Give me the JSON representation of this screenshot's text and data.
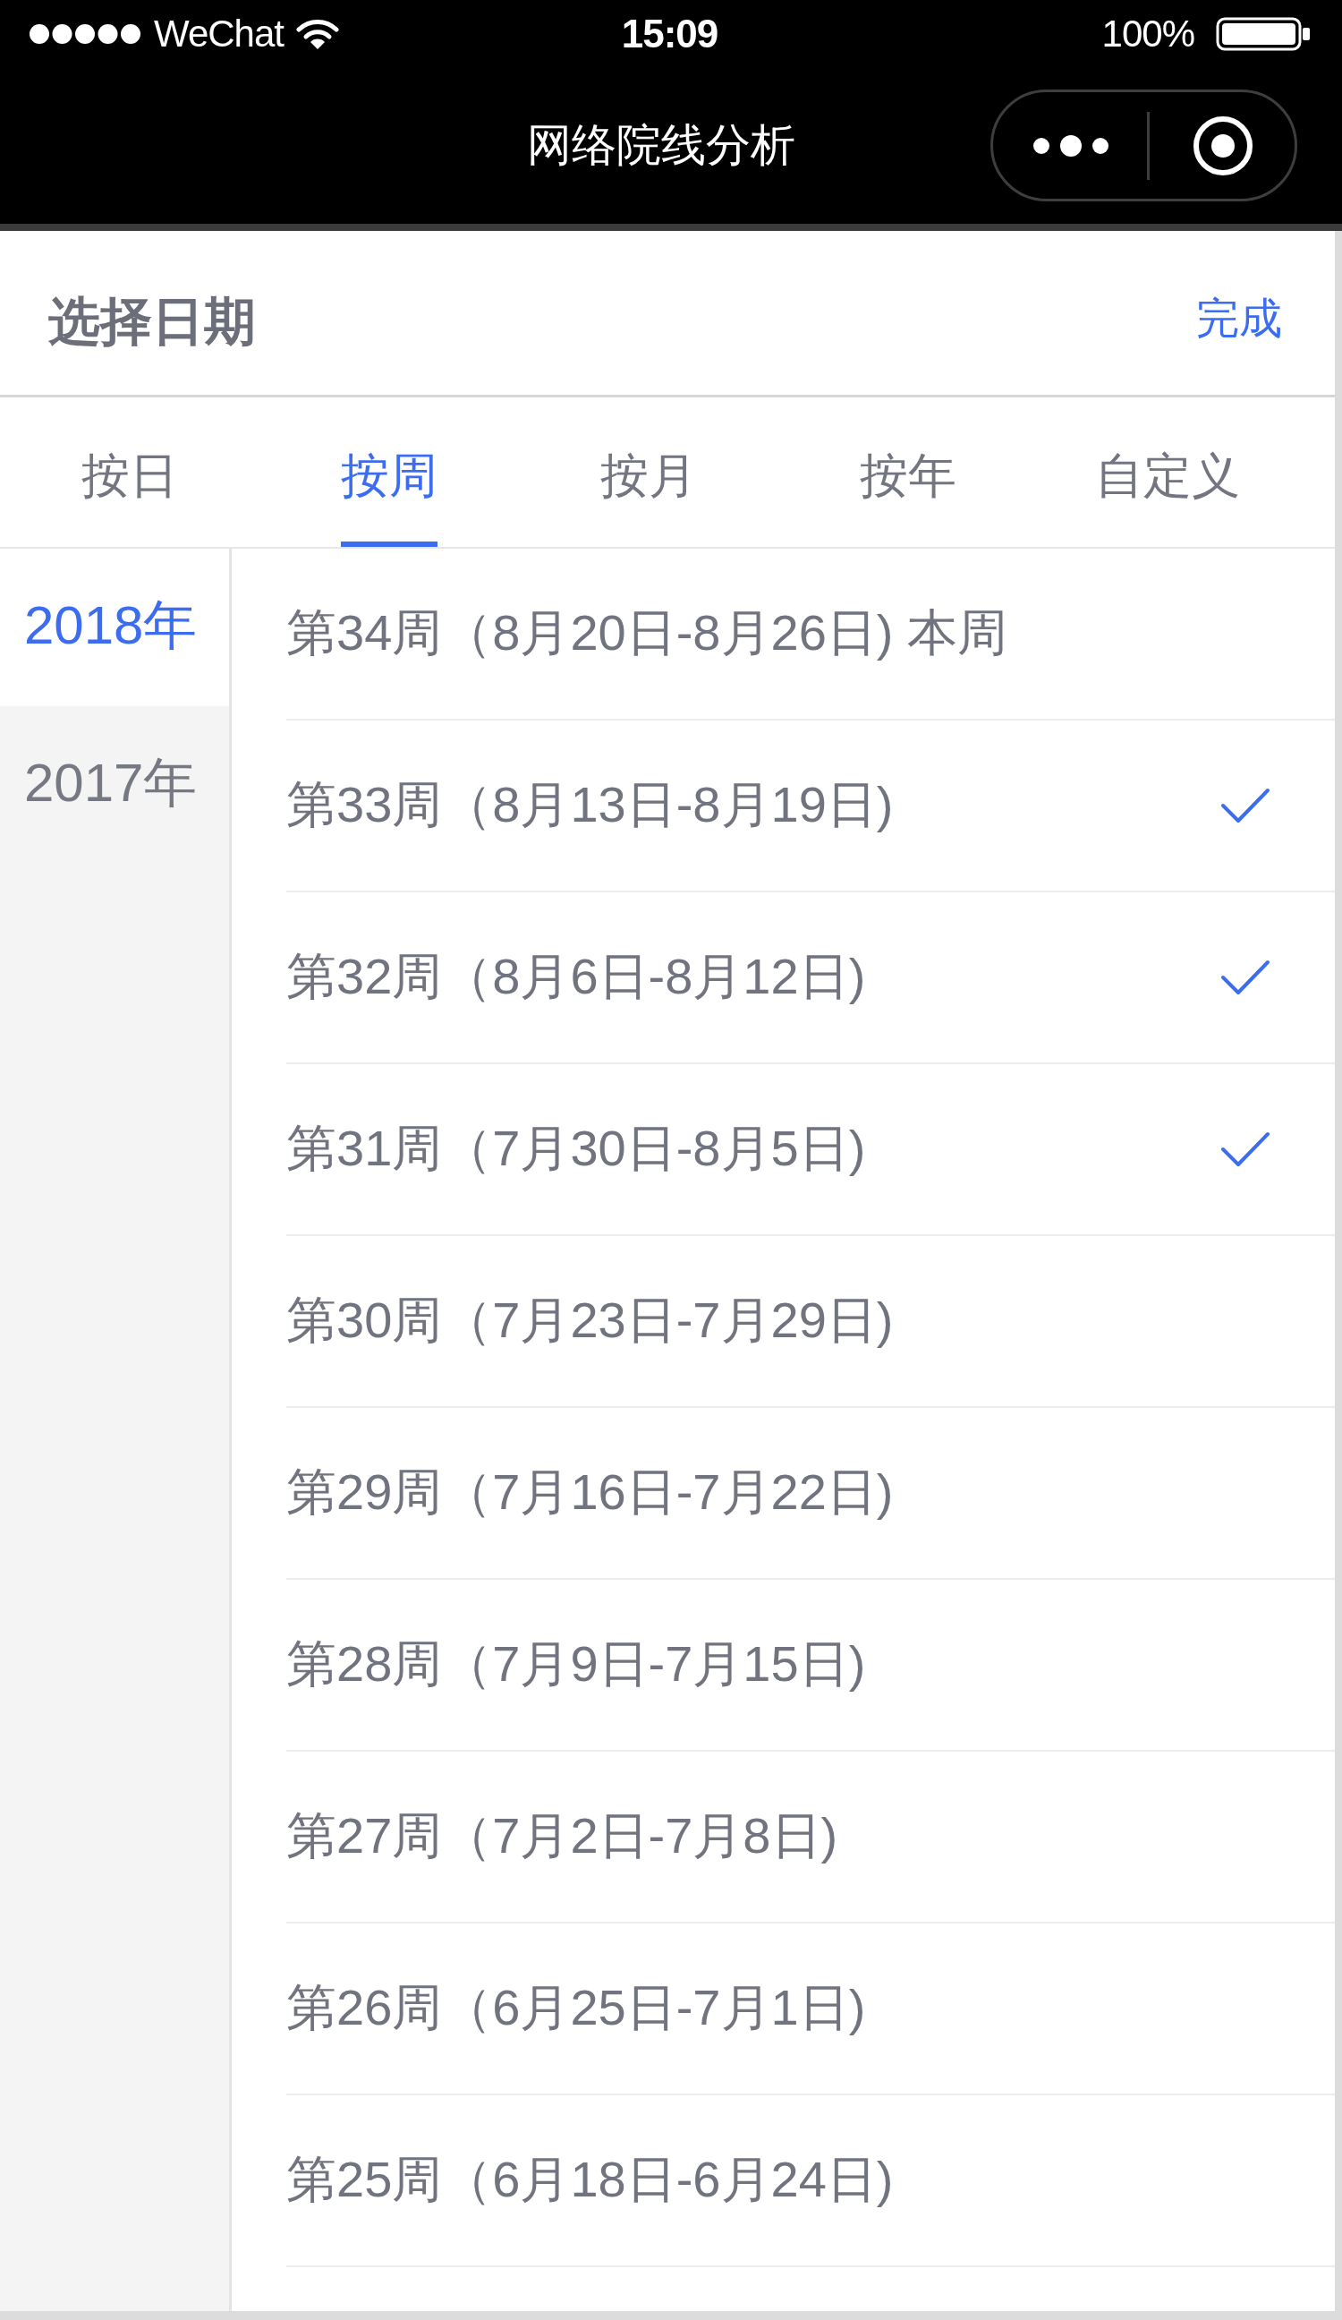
{
  "status_bar": {
    "carrier": "WeChat",
    "time": "15:09",
    "battery": "100%"
  },
  "nav_bar": {
    "title": "网络院线分析"
  },
  "header": {
    "title": "选择日期",
    "action": "完成"
  },
  "tabs": [
    {
      "label": "按日",
      "selected": false
    },
    {
      "label": "按周",
      "selected": true
    },
    {
      "label": "按月",
      "selected": false
    },
    {
      "label": "按年",
      "selected": false
    },
    {
      "label": "自定义",
      "selected": false
    }
  ],
  "years": [
    {
      "label": "2018年",
      "selected": true
    },
    {
      "label": "2017年",
      "selected": false
    }
  ],
  "weeks": [
    {
      "label": "第34周（8月20日-8月26日) 本周",
      "checked": false
    },
    {
      "label": "第33周（8月13日-8月19日)",
      "checked": true
    },
    {
      "label": "第32周（8月6日-8月12日)",
      "checked": true
    },
    {
      "label": "第31周（7月30日-8月5日)",
      "checked": true
    },
    {
      "label": "第30周（7月23日-7月29日)",
      "checked": false
    },
    {
      "label": "第29周（7月16日-7月22日)",
      "checked": false
    },
    {
      "label": "第28周（7月9日-7月15日)",
      "checked": false
    },
    {
      "label": "第27周（7月2日-7月8日)",
      "checked": false
    },
    {
      "label": "第26周（6月25日-7月1日)",
      "checked": false
    },
    {
      "label": "第25周（6月18日-6月24日)",
      "checked": false
    }
  ]
}
